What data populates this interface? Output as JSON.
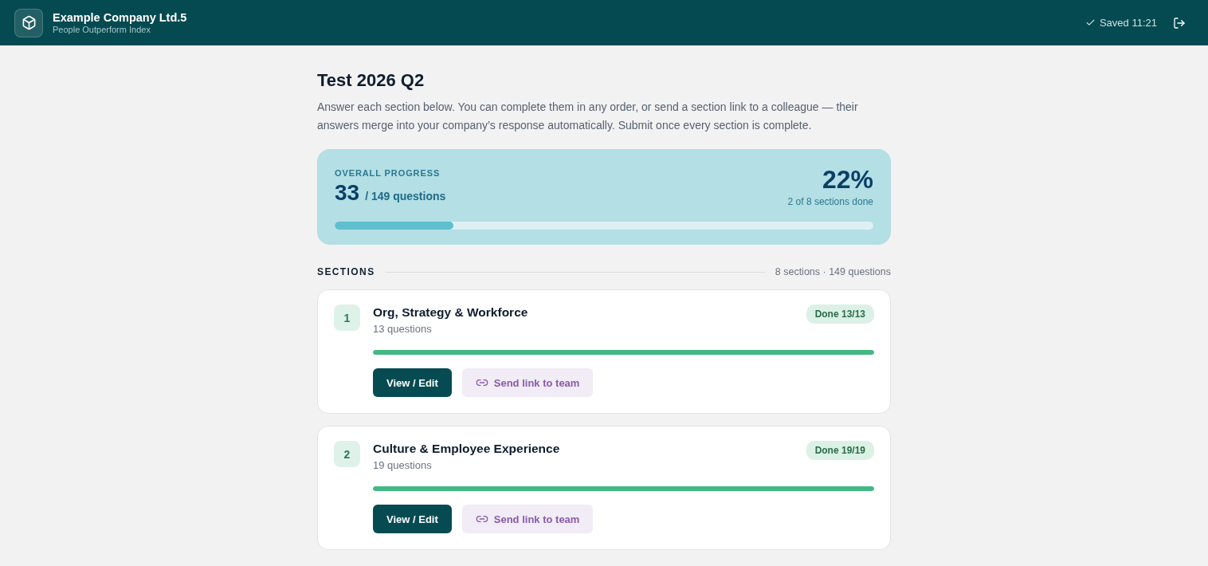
{
  "header": {
    "company": "Example Company Ltd.5",
    "product": "People Outperform Index",
    "save_status": "Saved 11:21"
  },
  "page": {
    "title": "Test 2026 Q2",
    "intro": "Answer each section below. You can complete them in any order, or send a section link to a colleague — their answers merge into your company’s response automatically. Submit once every section is complete."
  },
  "overall_progress": {
    "label": "OVERALL PROGRESS",
    "answered": "33",
    "total": "/ 149 questions",
    "percent": "22%",
    "sections_done": "2 of 8 sections done",
    "level": 0.22
  },
  "sections_header": {
    "label": "SECTIONS",
    "summary": "8 sections · 149 questions"
  },
  "sections": [
    {
      "number": "1",
      "title": "Org, Strategy & Workforce",
      "questions": "13 questions",
      "complete": true,
      "badge": "Done 13/13",
      "level": 1,
      "actions": [
        {
          "kind": "primary",
          "label": "View / Edit"
        },
        {
          "kind": "share",
          "label": "Send link to team"
        }
      ]
    },
    {
      "number": "2",
      "title": "Culture & Employee Experience",
      "questions": "19 questions",
      "complete": true,
      "badge": "Done 19/19",
      "level": 1,
      "actions": [
        {
          "kind": "primary",
          "label": "View / Edit"
        },
        {
          "kind": "share",
          "label": "Send link to team"
        }
      ]
    }
  ]
}
